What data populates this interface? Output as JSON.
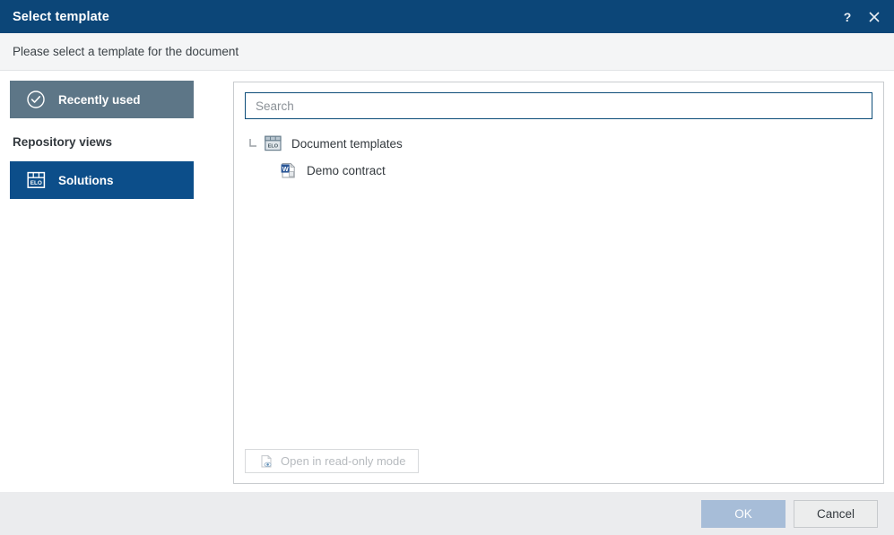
{
  "window": {
    "title": "Select template",
    "help_icon": "question-mark-icon",
    "close_icon": "close-icon"
  },
  "subtitle": {
    "text": "Please select a template for the document"
  },
  "sidebar": {
    "items": [
      {
        "label": "Recently used",
        "icon": "check-circle-icon",
        "state": "selected-muted"
      },
      {
        "label": "Solutions",
        "icon": "elo-archive-icon",
        "state": "selected"
      }
    ],
    "heading": "Repository views"
  },
  "panel": {
    "search": {
      "placeholder": "Search",
      "value": "",
      "icon": "search-icon"
    },
    "tree": [
      {
        "label": "Document templates",
        "icon": "elo-folder-icon",
        "toggle": "collapse-marker-icon",
        "level": 0
      },
      {
        "label": "Demo contract",
        "icon": "word-document-icon",
        "level": 1
      }
    ],
    "readonly_button": {
      "label": "Open in read-only mode",
      "icon": "document-eye-icon",
      "enabled": false
    }
  },
  "footer": {
    "ok_label": "OK",
    "cancel_label": "Cancel"
  },
  "colors": {
    "title_bar": "#0c4678",
    "accent_blue": "#0c4e8a",
    "muted_slate": "#5d7687",
    "search_border": "#0d4d79",
    "ok_disabled": "#a7bdd8",
    "footer_bg": "#ebecee"
  }
}
